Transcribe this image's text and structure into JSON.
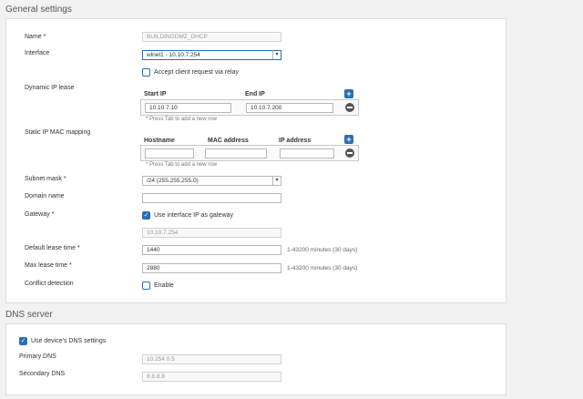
{
  "general": {
    "title": "General settings",
    "name_label": "Name *",
    "name_value": "BUILDINGDMZ_DHCP",
    "interface_label": "Interface",
    "interface_value": "wlnet1 - 10.10.7.254",
    "accept_relay_label": "Accept client request via relay",
    "dynamic_label": "Dynamic IP lease",
    "start_ip_header": "Start IP",
    "end_ip_header": "End IP",
    "start_ip_value": "10.10.7.10",
    "end_ip_value": "10.10.7.200",
    "tab_hint_1": "* Press Tab to add a new row",
    "static_label": "Static IP MAC mapping",
    "hostname_header": "Hostname",
    "mac_header": "MAC address",
    "ipaddr_header": "IP address",
    "tab_hint_2": "* Press Tab to add a new row",
    "subnet_label": "Subnet mask *",
    "subnet_value": "/24 (255.255.255.0)",
    "domain_label": "Domain name",
    "gateway_label": "Gateway *",
    "use_iface_gw_label": "Use interface IP as gateway",
    "gateway_value": "10.10.7.254",
    "default_lease_label": "Default lease time *",
    "default_lease_value": "1440",
    "default_lease_suffix": "1-43200 minutes (30 days)",
    "max_lease_label": "Max lease time *",
    "max_lease_value": "2880",
    "max_lease_suffix": "1-43200 minutes (30 days)",
    "conflict_label": "Conflict detection",
    "enable_label": "Enable"
  },
  "dns": {
    "title": "DNS server",
    "use_device_label": "Use device's DNS settings",
    "primary_label": "Primary DNS",
    "primary_value": "10.254.0.5",
    "secondary_label": "Secondary DNS",
    "secondary_value": "8.8.8.8"
  },
  "icons": {
    "plus": "plus-icon",
    "minus": "minus-icon",
    "check": "check-icon",
    "dropdown": "chevron-down-icon"
  },
  "colors": {
    "accent": "#2a6fb5"
  }
}
